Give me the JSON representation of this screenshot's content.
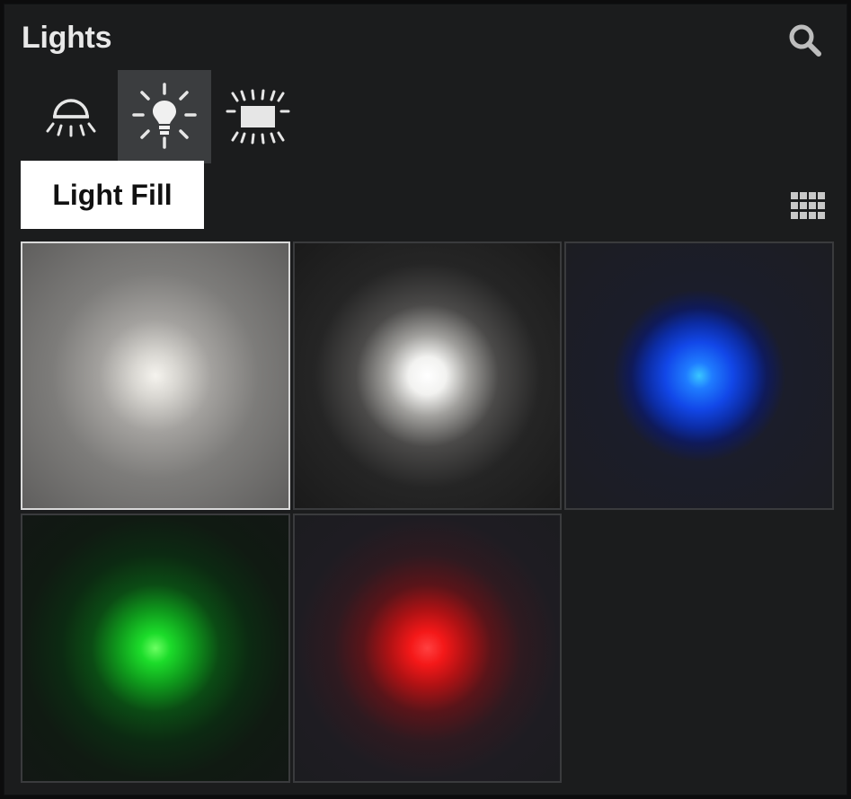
{
  "panel": {
    "title": "Lights",
    "search_icon": "search-icon",
    "grid_icon": "grid-view-icon"
  },
  "tabs": [
    {
      "icon": "ceiling-light-icon",
      "active": false
    },
    {
      "icon": "light-bulb-icon",
      "active": true
    },
    {
      "icon": "light-panel-icon",
      "active": false
    }
  ],
  "tooltip": {
    "text": "Light Fill"
  },
  "presets": [
    {
      "color": "#ffffff",
      "selected": true
    },
    {
      "color": "#ffffff",
      "selected": false
    },
    {
      "color": "#1a4dff",
      "selected": false
    },
    {
      "color": "#1ae02a",
      "selected": false
    },
    {
      "color": "#ff1a1a",
      "selected": false
    }
  ]
}
